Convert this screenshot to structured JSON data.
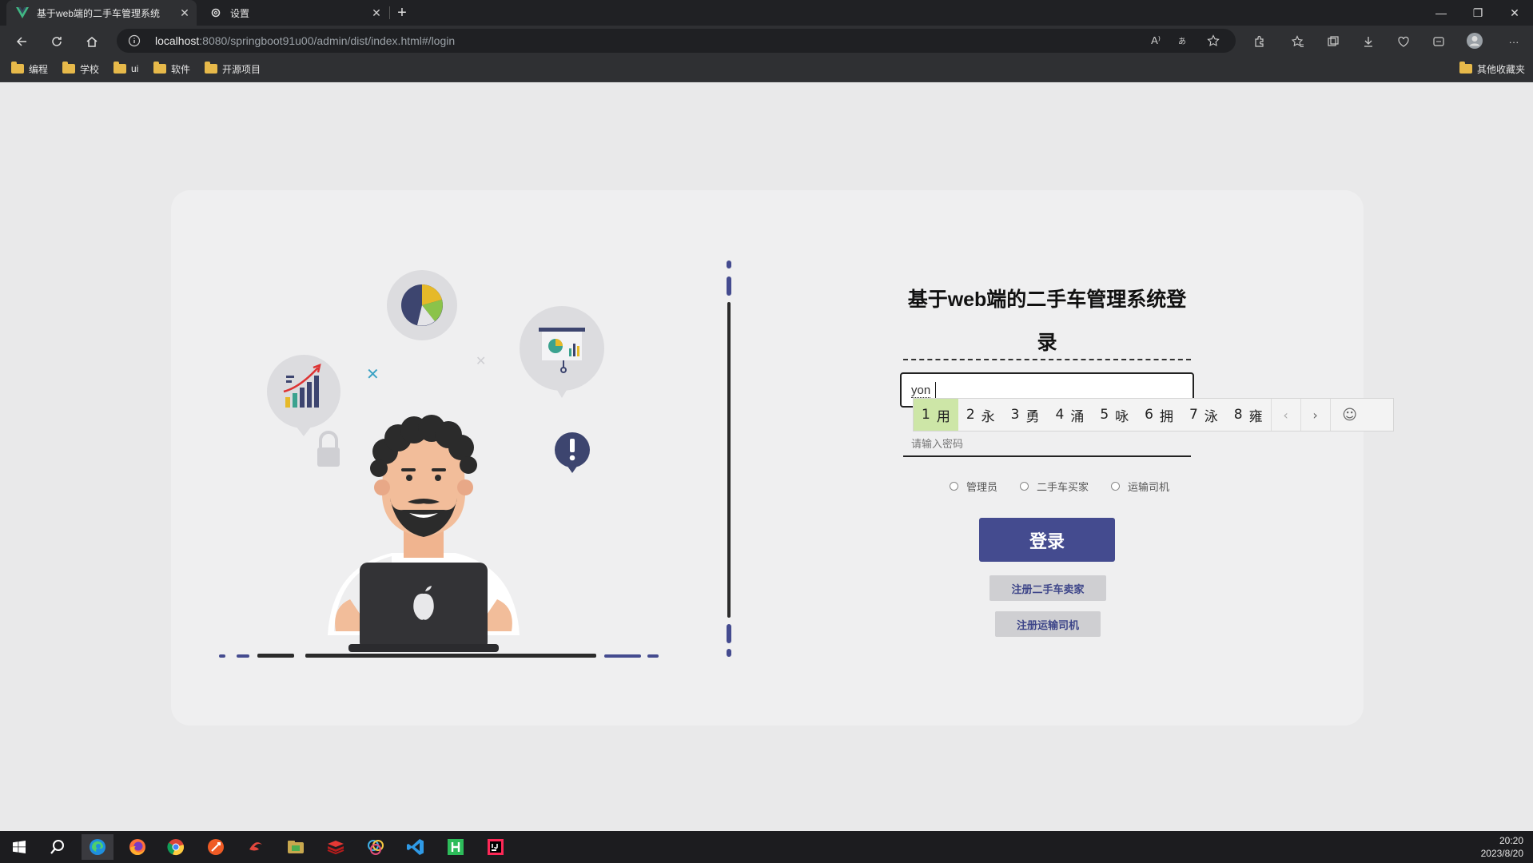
{
  "browser": {
    "tabs": [
      {
        "title": "基于web端的二手车管理系统",
        "active": true
      },
      {
        "title": "设置",
        "active": false
      }
    ],
    "url_host": "localhost",
    "url_rest": ":8080/springboot91u00/admin/dist/index.html#/login",
    "read_aloud": "A⁾",
    "bookmarks": [
      "编程",
      "学校",
      "ui",
      "软件",
      "开源项目"
    ],
    "other_bookmarks": "其他收藏夹"
  },
  "login": {
    "title": "基于web端的二手车管理系统登录",
    "username_value": "yon",
    "password_placeholder": "请输入密码",
    "roles": [
      "管理员",
      "二手车买家",
      "运输司机"
    ],
    "login_button": "登录",
    "register_seller": "注册二手车卖家",
    "register_driver": "注册运输司机"
  },
  "ime": {
    "candidates": [
      {
        "n": "1",
        "c": "用"
      },
      {
        "n": "2",
        "c": "永"
      },
      {
        "n": "3",
        "c": "勇"
      },
      {
        "n": "4",
        "c": "涌"
      },
      {
        "n": "5",
        "c": "咏"
      },
      {
        "n": "6",
        "c": "拥"
      },
      {
        "n": "7",
        "c": "泳"
      },
      {
        "n": "8",
        "c": "雍"
      }
    ],
    "prev": "‹",
    "next": "›",
    "emoji": "☺"
  },
  "taskbar": {
    "time": "20:20",
    "date": "2023/8/20"
  },
  "colors": {
    "accent": "#444b8f",
    "card": "#efeff0",
    "page_bg": "#e9e9ea"
  }
}
